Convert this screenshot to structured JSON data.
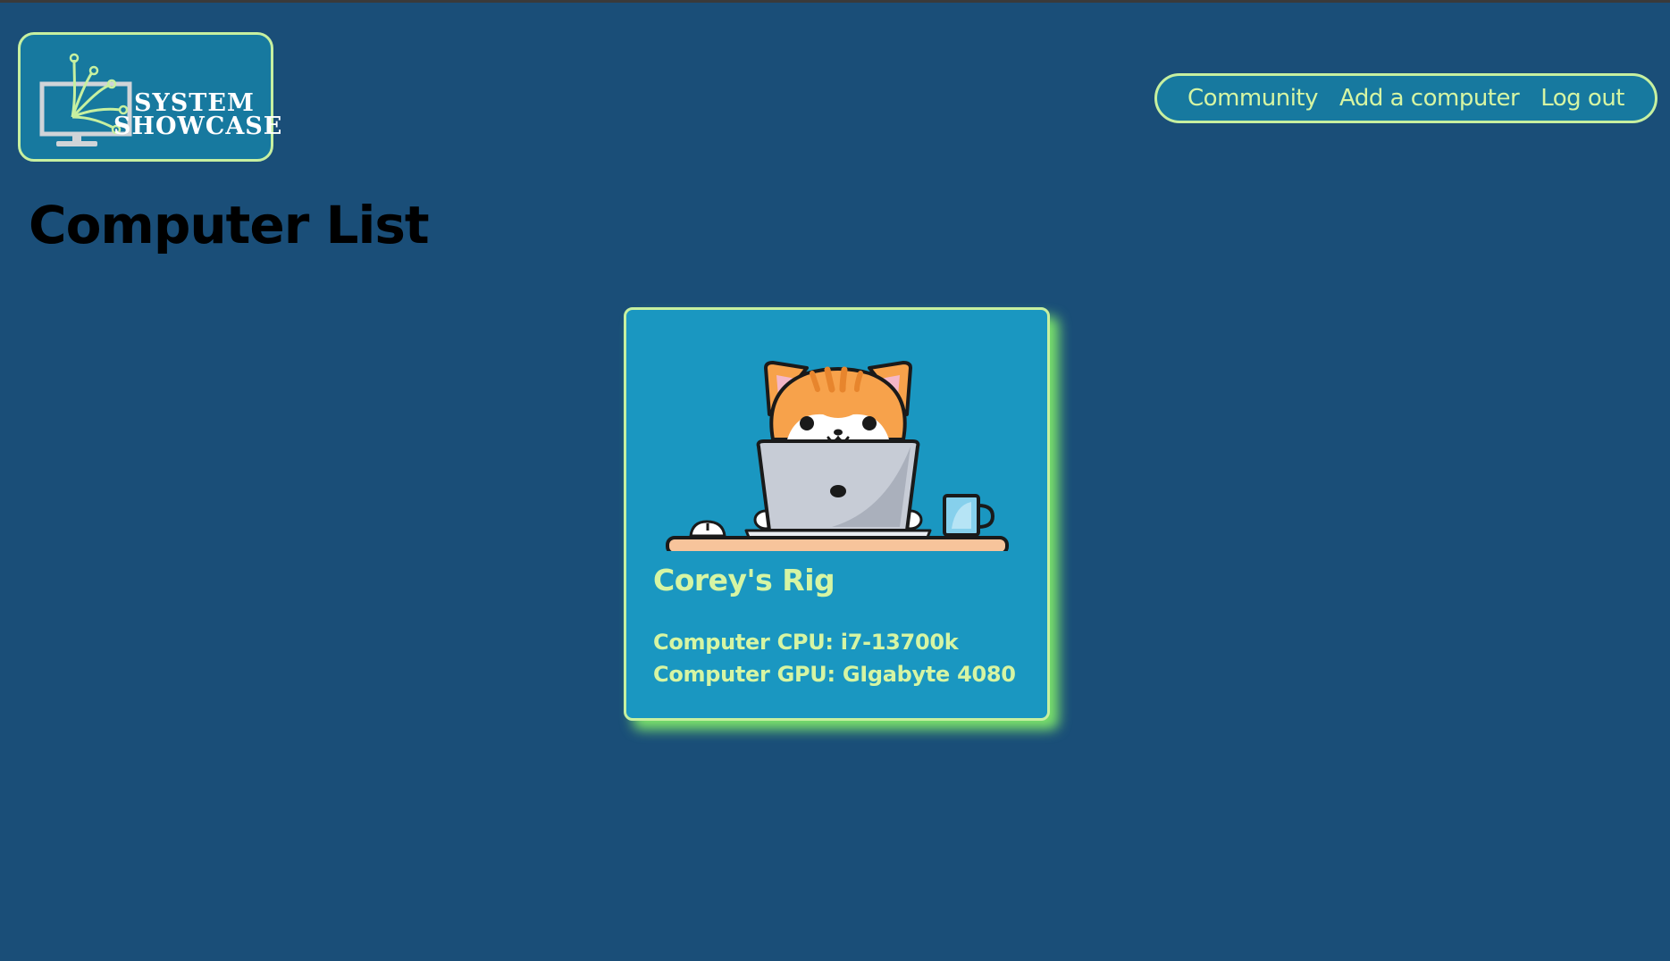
{
  "logo": {
    "line1": "SYSTEM",
    "line2": "SHOWCASE"
  },
  "nav": {
    "items": [
      "Community",
      "Add a computer",
      "Log out"
    ]
  },
  "page_title": "Computer List",
  "computers": [
    {
      "name": "Corey's Rig",
      "cpu_label": "Computer CPU: i7-13700k",
      "gpu_label": "Computer GPU: GIgabyte 4080",
      "image": "cat-with-laptop-illustration"
    }
  ],
  "colors": {
    "background": "#1a4e78",
    "panel": "#17799f",
    "card": "#1a97c1",
    "accent_text": "#d6f5a3",
    "border": "#c7f0a0",
    "card_glow": "#7be36b"
  }
}
